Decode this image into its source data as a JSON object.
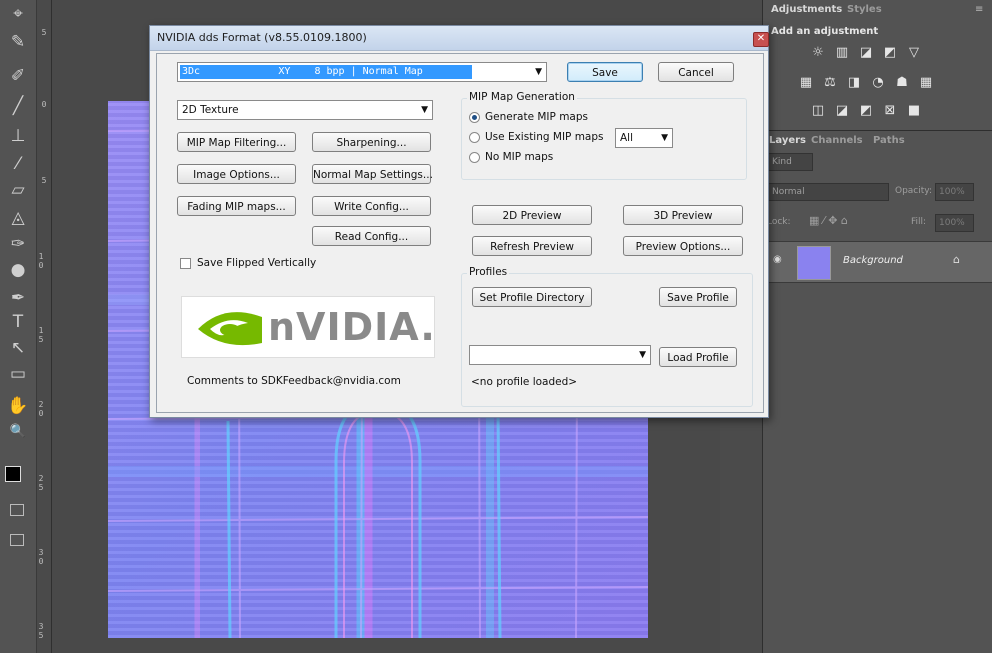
{
  "app": {
    "left_toolbar": {
      "tools": [
        "move-tool",
        "brush-tool",
        "spot-healing-tool",
        "brush-tool-2",
        "clone-stamp-tool",
        "history-brush-tool",
        "eraser-tool",
        "paint-bucket-tool",
        "blur-tool",
        "dodge-tool",
        "pen-tool",
        "type-tool",
        "path-selection-tool",
        "rectangle-tool",
        "hand-tool",
        "zoom-tool"
      ],
      "tool_glyphs": [
        "⌖",
        "✎",
        "✐",
        "╱",
        "⊥",
        "⁄",
        "▱",
        "◬",
        "✑",
        "●",
        "✒",
        "T",
        "↖",
        "▭",
        "✋",
        "🔍"
      ]
    },
    "ruler_marks": [
      "5",
      "0",
      "5",
      "1 0",
      "1 5",
      "2 0",
      "2 5",
      "3 0",
      "3 5"
    ],
    "layers": {
      "tabs": {
        "adjustments": "Adjustments",
        "styles": "Styles",
        "layers": "Layers",
        "channels": "Channels",
        "paths": "Paths"
      },
      "add_adjustment": "Add an adjustment",
      "kind_label": "Kind",
      "blend_mode": "Normal",
      "opacity_label": "Opacity:",
      "opacity_value": "100%",
      "lock_label": "Lock:",
      "fill_label": "Fill:",
      "fill_value": "100%",
      "layer_name": "Background"
    }
  },
  "dialog": {
    "title": "NVIDIA dds Format (v8.55.0109.1800)",
    "format_value": "3Dc             XY    8 bpp | Normal Map",
    "save_label": "Save",
    "cancel_label": "Cancel",
    "texture_type": "2D Texture",
    "buttons": {
      "mip_filtering": "MIP Map Filtering...",
      "sharpening": "Sharpening...",
      "image_options": "Image Options...",
      "normal_map_settings": "Normal Map Settings...",
      "fading_mip": "Fading MIP maps...",
      "write_config": "Write Config...",
      "read_config": "Read Config...",
      "preview_2d": "2D Preview",
      "preview_3d": "3D Preview",
      "refresh_preview": "Refresh Preview",
      "preview_options": "Preview Options...",
      "set_profile_dir": "Set Profile Directory",
      "save_profile": "Save Profile",
      "load_profile": "Load Profile"
    },
    "save_flipped_label": "Save Flipped Vertically",
    "mip_group": {
      "title": "MIP Map Generation",
      "generate": "Generate MIP maps",
      "use_existing": "Use Existing MIP maps",
      "no_mip": "No MIP maps",
      "existing_value": "All"
    },
    "profiles_group": {
      "title": "Profiles",
      "profile_select_value": "",
      "status": "<no profile loaded>"
    },
    "logo_text": "nVIDIA.",
    "comments": "Comments to SDKFeedback@nvidia.com"
  }
}
